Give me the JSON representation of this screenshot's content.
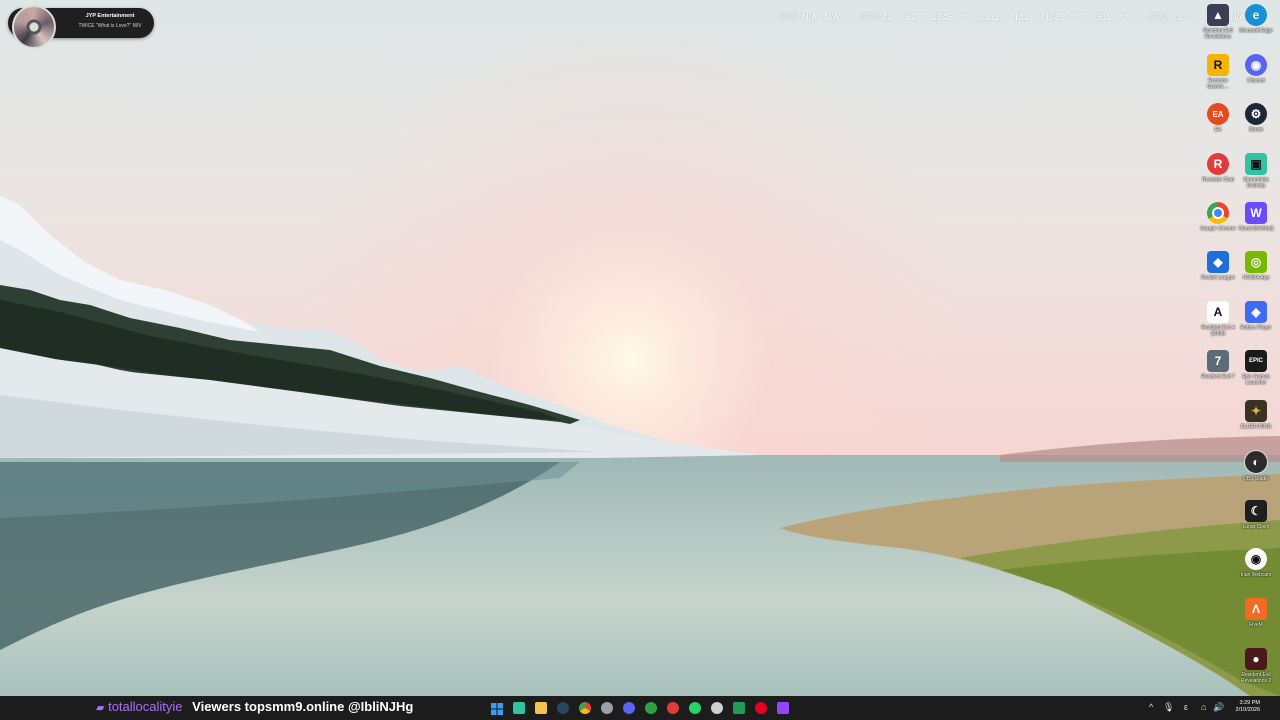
{
  "now_playing": {
    "artist": "JYP Entertainment",
    "track": "TWICE \"What is Love?\" M/V"
  },
  "stats": {
    "fps_label": "FPS",
    "fps_value": "N/A",
    "fps_value2": "N/A",
    "gpu_label": "GPU",
    "gpu_util": "42",
    "gpu_util_unit": "%",
    "gpu_temp": "62",
    "gpu_temp_unit": "°C",
    "gpu_clock": "1845",
    "gpu_clock_unit": "MHz",
    "gpu_voltage": "0.912",
    "gpu_voltage_unit": "V",
    "gpu_power": "142",
    "gpu_power_unit": "W",
    "gpu_fan": "1089",
    "gpu_fan_unit": "RPM",
    "gpu_mem_clock": "9501",
    "gpu_mem_clock_unit": "MHz",
    "cpu_label": "CPU",
    "cpu_util": "22",
    "cpu_util_unit": "%",
    "extra": "N/A"
  },
  "desktop_icons": [
    {
      "label": "Resident Evil Revelations",
      "icon": "re-revelations-icon",
      "color": "#3a3f55"
    },
    {
      "label": "Microsoft Edge",
      "icon": "edge-icon",
      "color": "#1b8fd6"
    },
    {
      "label": "Rockstar Games ...",
      "icon": "rockstar-icon",
      "color": "#f4b400"
    },
    {
      "label": "Discord",
      "icon": "discord-icon",
      "color": "#5865f2"
    },
    {
      "label": "EA",
      "icon": "ea-icon",
      "color": "#e8491d"
    },
    {
      "label": "Steam",
      "icon": "steam-icon",
      "color": "#1b2838"
    },
    {
      "label": "Rockstar Chat",
      "icon": "rockstar-chat-icon",
      "color": "#e23b3b"
    },
    {
      "label": "Streamlabs Desktop",
      "icon": "streamlabs-icon",
      "color": "#31c3a2"
    },
    {
      "label": "Google Chrome",
      "icon": "chrome-icon",
      "color": "#ffffff"
    },
    {
      "label": "Wand (WeMod)",
      "icon": "wand-icon",
      "color": "#6a4cff"
    },
    {
      "label": "Rocket League",
      "icon": "rocket-league-icon",
      "color": "#1e6fd9"
    },
    {
      "label": "NVIDIA App",
      "icon": "nvidia-icon",
      "color": "#76b900"
    },
    {
      "label": "Resident Evil 4 (2005)",
      "icon": "re4-icon",
      "color": "#ffffff"
    },
    {
      "label": "Roblox Player",
      "icon": "roblox-icon",
      "color": "#3d6cf2"
    },
    {
      "label": "Resident Evil 7",
      "icon": "re7-icon",
      "color": "#5c6b78"
    },
    {
      "label": "Epic Games Launcher",
      "icon": "epic-icon",
      "color": "#1a1a1a"
    },
    {
      "label": "ELDEN RING",
      "icon": "elden-ring-icon",
      "color": "#3b3320"
    },
    {
      "label": "OBS Studio",
      "icon": "obs-icon",
      "color": "#2b2b2b"
    },
    {
      "label": "Lunar Client",
      "icon": "lunar-client-icon",
      "color": "#1f1f1f"
    },
    {
      "label": "Iriun Webcam",
      "icon": "iriun-icon",
      "color": "#ffffff"
    },
    {
      "label": "FiveM",
      "icon": "fivem-icon",
      "color": "#f26b21"
    },
    {
      "label": "Resident Evil Revelations 2",
      "icon": "re-revelations2-icon",
      "color": "#4a1a1a"
    }
  ],
  "taskbar": {
    "stream_user": "totallocalityie",
    "stream_message": "Viewers topsmm9.online @IbliNJHg",
    "apps": [
      {
        "name": "start-icon",
        "color": "#3b9cf0"
      },
      {
        "name": "streamlabs-icon",
        "color": "#31c3a2"
      },
      {
        "name": "file-explorer-icon",
        "color": "#f2c14e"
      },
      {
        "name": "steam-icon",
        "color": "#2a475e"
      },
      {
        "name": "chrome-icon",
        "color": "#e8453c"
      },
      {
        "name": "settings-icon",
        "color": "#9aa0a6"
      },
      {
        "name": "discord-icon",
        "color": "#5865f2"
      },
      {
        "name": "xbox-icon",
        "color": "#2ca243"
      },
      {
        "name": "rockstar-icon",
        "color": "#e23b3b"
      },
      {
        "name": "whatsapp-icon",
        "color": "#25d366"
      },
      {
        "name": "obs-icon",
        "color": "#d0d0d0"
      },
      {
        "name": "excel-icon",
        "color": "#1f9d55"
      },
      {
        "name": "pinterest-icon",
        "color": "#e60023"
      },
      {
        "name": "twitch-icon",
        "color": "#9146ff"
      }
    ],
    "tray": {
      "chevron": "^",
      "mic": "🎙",
      "language": "ε",
      "network": "⌂",
      "volume": "🔊"
    },
    "time": "3:29 PM",
    "date": "2/10/2026"
  },
  "colors": {
    "taskbar_bg": "#1c1c1c",
    "twitch_purple": "#a970ff"
  }
}
